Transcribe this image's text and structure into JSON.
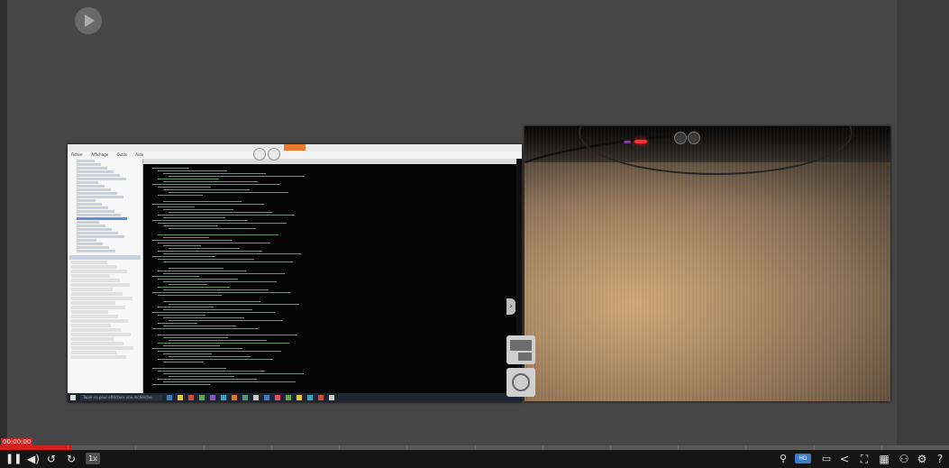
{
  "recording": {
    "timecode": "00:00:00",
    "progress_pct": 7.5
  },
  "screen_capture": {
    "window_title": "",
    "menu": [
      "Fichier",
      "Affichage",
      "Outils",
      "Aide"
    ],
    "taskbar_search_placeholder": "Taper ici pour effectuer une recherche"
  },
  "controls": {
    "speed_label": "1x",
    "hd_label": "HD",
    "play_icon": "pause-icon"
  },
  "colors": {
    "progress": "#d02020",
    "accent": "#3d7cc9"
  }
}
